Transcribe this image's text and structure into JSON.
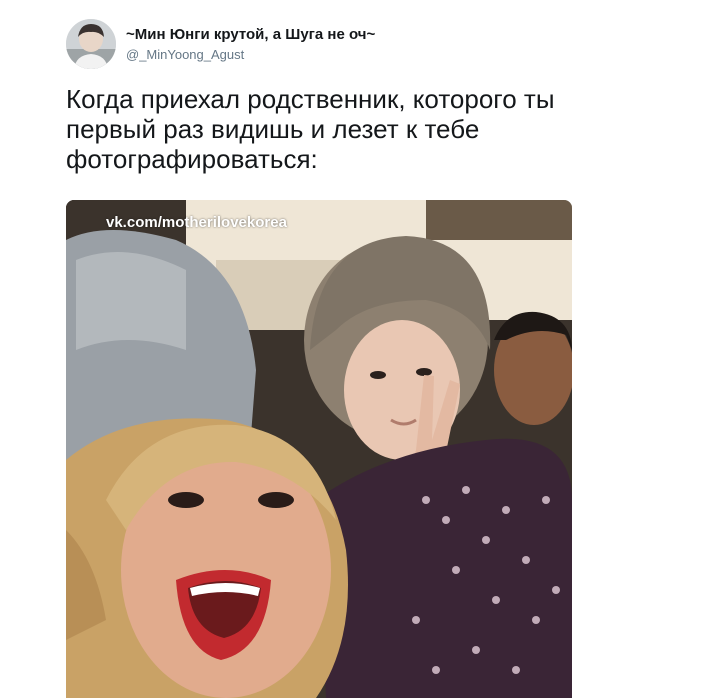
{
  "tweet": {
    "display_name": "~Мин Юнги крутой, а Шуга не оч~",
    "handle": "@_MinYoong_Agust",
    "text": "Когда приехал родственник, которого ты первый раз видишь и лезет к тебе фотографироваться:"
  },
  "media": {
    "watermark": "vk.com/motherilovekorea"
  },
  "colors": {
    "text": "#14171a",
    "handle": "#657786",
    "background": "#ffffff"
  }
}
